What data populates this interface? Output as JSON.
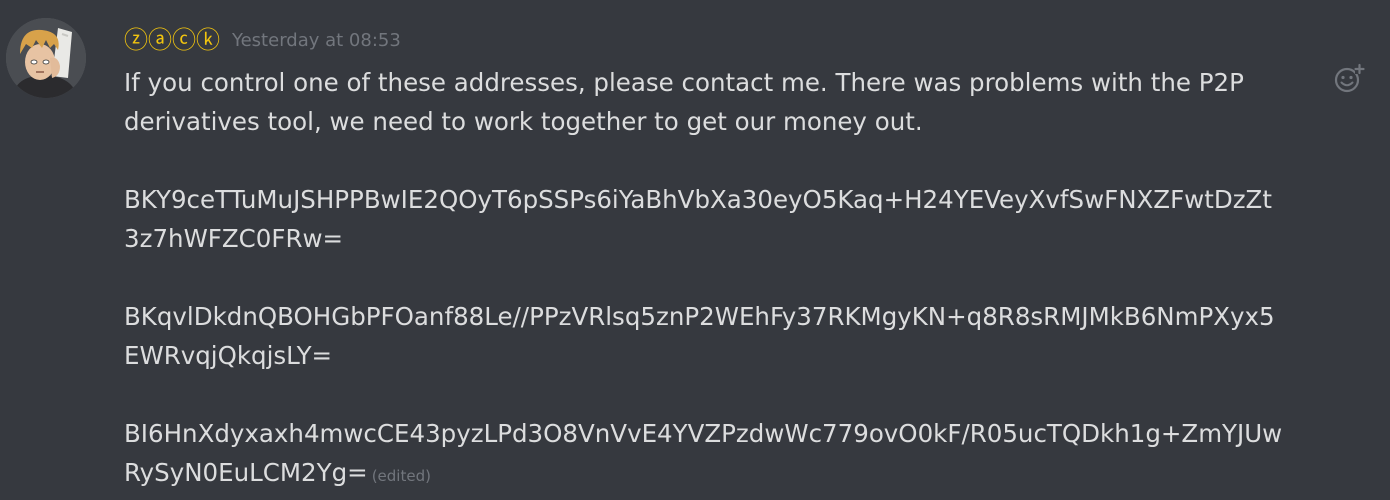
{
  "message": {
    "author": "ⓩⓐⓒⓚ",
    "author_color": "#f1c40f",
    "timestamp": "Yesterday at 08:53",
    "lines": {
      "l1": "If you control one of these addresses, please contact me. There was problems with the P2P",
      "l2": "derivatives tool, we need to work together to get our money out.",
      "a1a": "BKY9ceTTuMuJSHPPBwIE2QOyT6pSSPs6iYaBhVbXa30eyO5Kaq+H24YEVeyXvfSwFNXZFwtDzZt",
      "a1b": "3z7hWFZC0FRw=",
      "a2a": "BKqvlDkdnQBOHGbPFOanf88Le//PPzVRlsq5znP2WEhFy37RKMgyKN+q8R8sRMJMkB6NmPXyx5",
      "a2b": "EWRvqjQkqjsLY=",
      "a3a": "BI6HnXdyxaxh4mwcCE43pyzLPd3O8VnVvE4YVZPzdwWc779ovO0kF/R05ucTQDkh1g+ZmYJUw",
      "a3b": "RySyN0EuLCM2Yg="
    },
    "edited_label": "(edited)"
  },
  "icons": {
    "avatar": "avatar",
    "reaction": "add-reaction-icon"
  },
  "colors": {
    "background": "#36393f",
    "text": "#dcddde",
    "muted": "#72767d"
  }
}
